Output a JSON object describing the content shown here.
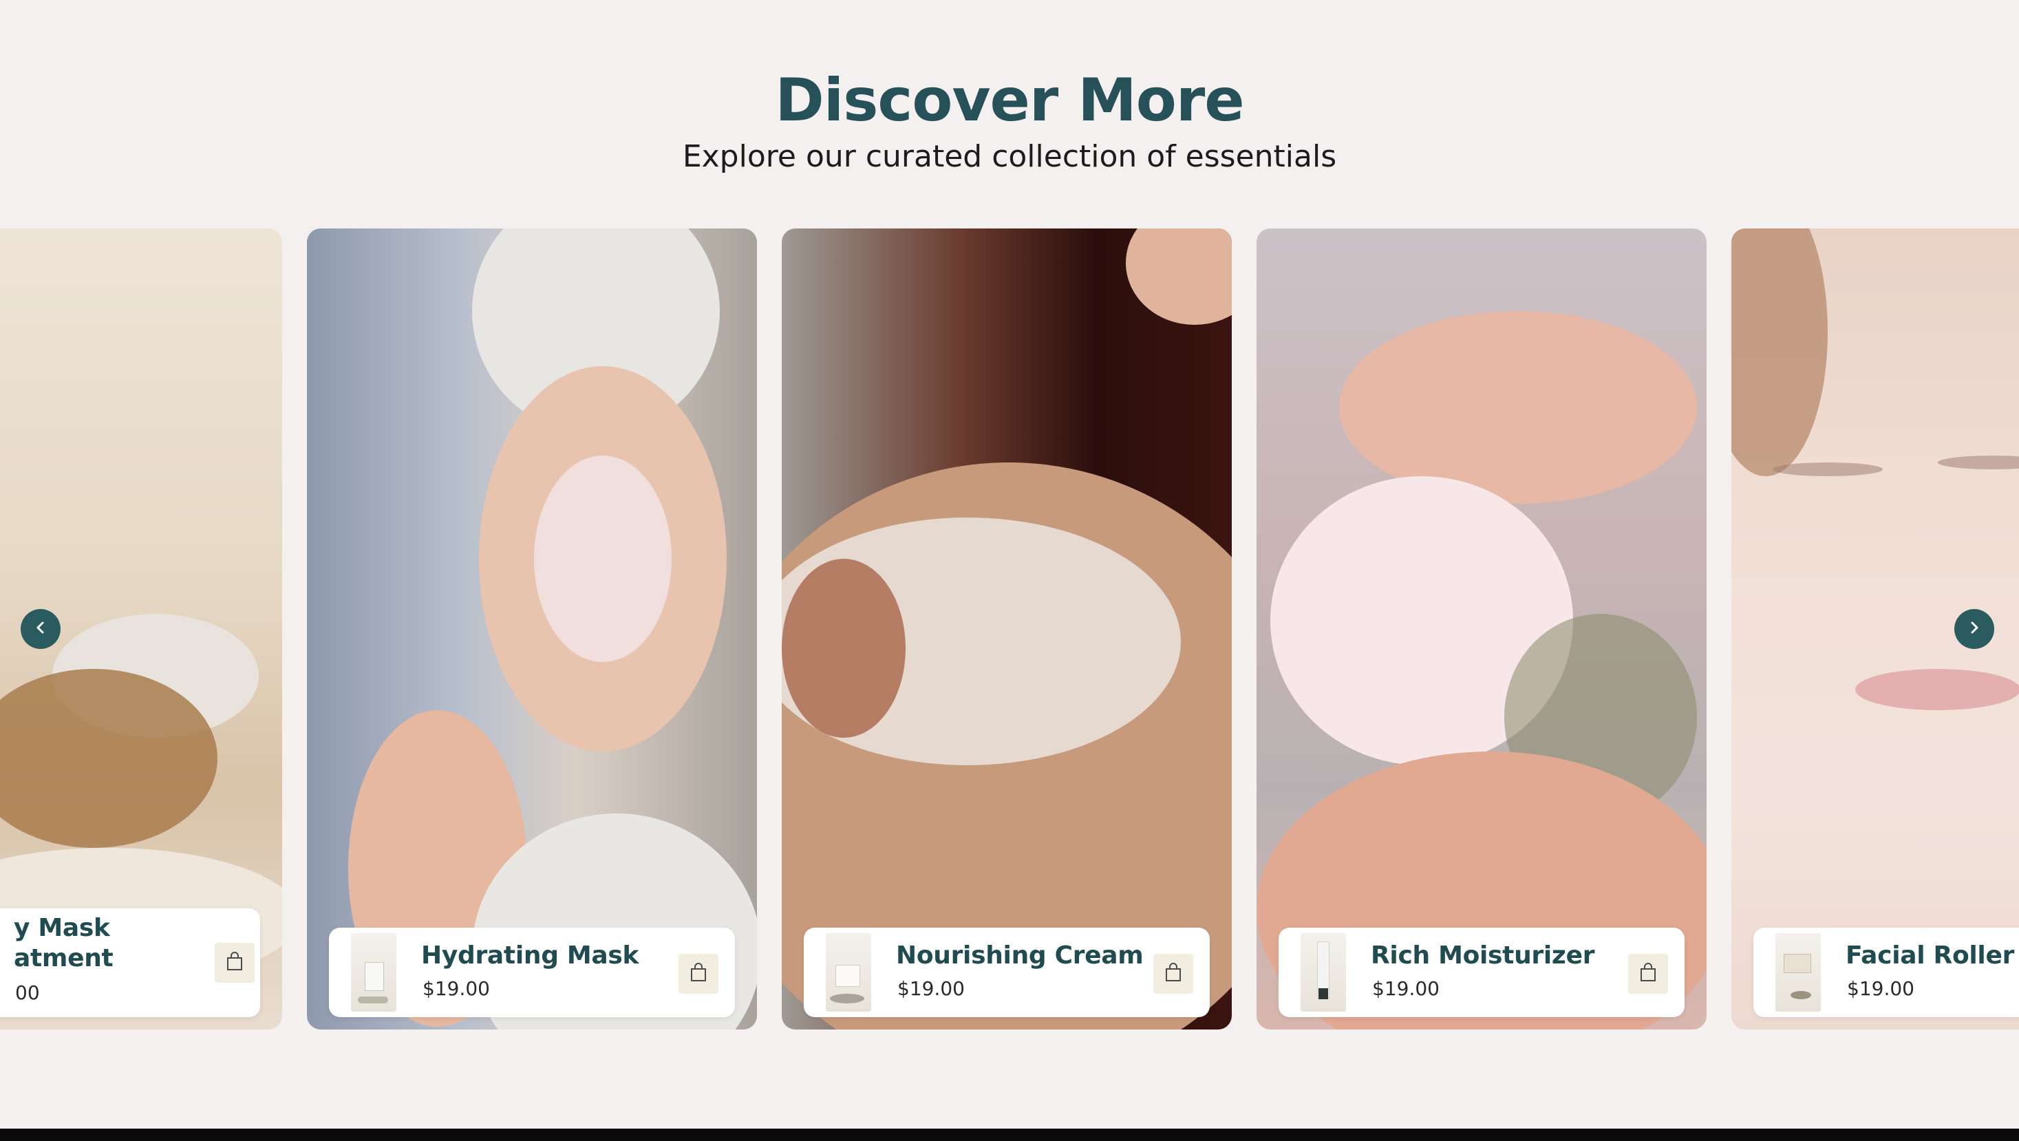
{
  "section": {
    "title": "Discover More",
    "subtitle": "Explore our curated collection of essentials"
  },
  "carousel": {
    "prev_icon": "chevron-left-icon",
    "next_icon": "chevron-right-icon",
    "products": [
      {
        "name_line1": "y Mask",
        "name_line2": "atment",
        "price": "00"
      },
      {
        "name": "Hydrating Mask",
        "price": "$19.00"
      },
      {
        "name": "Nourishing Cream",
        "price": "$19.00"
      },
      {
        "name": "Rich Moisturizer",
        "price": "$19.00"
      },
      {
        "name": "Facial Roller",
        "price": "$19.00"
      }
    ],
    "cart_icon": "shopping-bag-icon"
  },
  "colors": {
    "background": "#f3f0ef",
    "title": "#275158",
    "product_name": "#1f4b51",
    "nav_button": "#2a5b5f",
    "cart_button_bg": "#f2ede1"
  }
}
